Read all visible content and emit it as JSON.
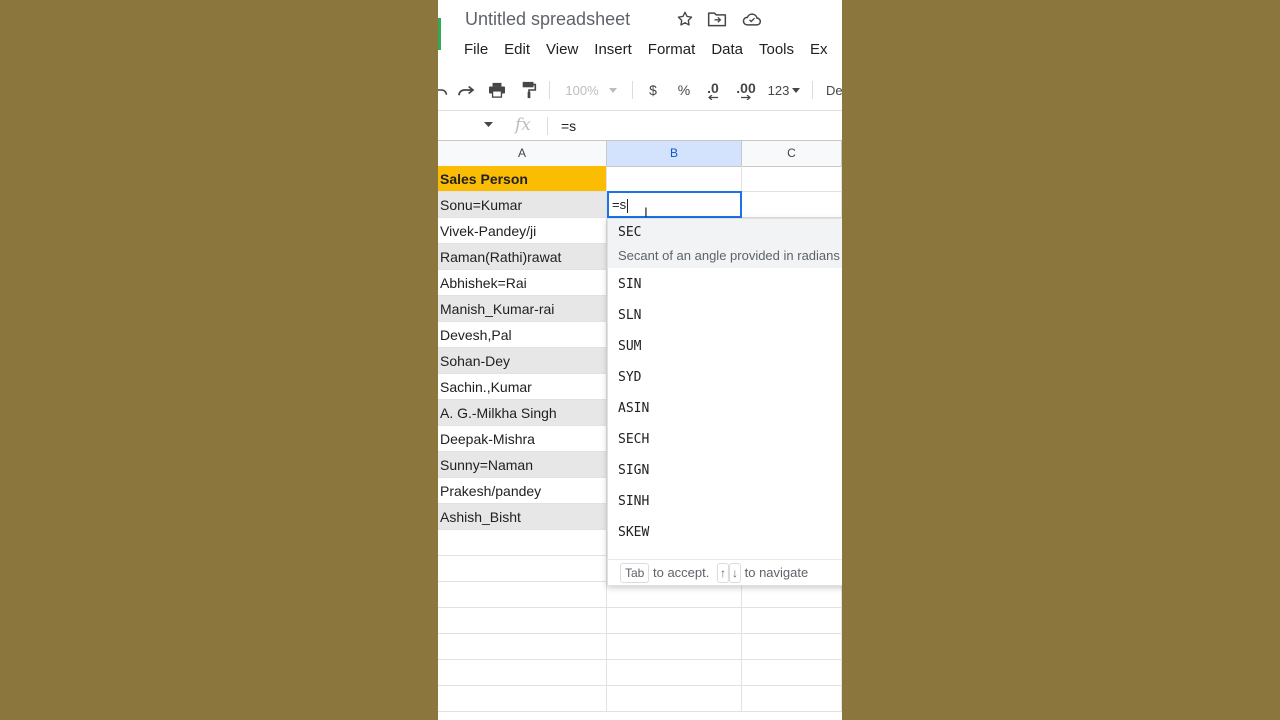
{
  "app": {
    "title": "Untitled spreadsheet",
    "accent": "#1a73e8",
    "brand": "#34a853",
    "header_fill": "#fbbc04"
  },
  "menu": [
    "File",
    "Edit",
    "View",
    "Insert",
    "Format",
    "Data",
    "Tools",
    "Ex"
  ],
  "toolbar": {
    "zoom": "100%",
    "currency": "$",
    "percent": "%",
    "dec_decrease": ".0",
    "dec_increase": ".00",
    "more_formats": "123",
    "font": "De"
  },
  "formula_bar": {
    "fx": "fx",
    "content": "=s"
  },
  "grid": {
    "columns": [
      "A",
      "B",
      "C"
    ],
    "rows": [
      "Sales Person",
      "Sonu=Kumar",
      "Vivek-Pandey/ji",
      "Raman(Rathi)rawat",
      "Abhishek=Rai",
      "Manish_Kumar-rai",
      "Devesh,Pal",
      "Sohan-Dey",
      "Sachin.,Kumar",
      "A. G.-Milkha Singh",
      "Deepak-Mishra",
      "Sunny=Naman",
      "Prakesh/pandey",
      "Ashish_Bisht"
    ],
    "editing_value": "=s"
  },
  "autocomplete": {
    "first": {
      "name": "SEC",
      "desc": "Secant of an angle provided in radians"
    },
    "items": [
      "SIN",
      "SLN",
      "SUM",
      "SYD",
      "ASIN",
      "SECH",
      "SIGN",
      "SINH",
      "SKEW"
    ],
    "footer": {
      "tab": "Tab",
      "accept": "to accept.",
      "up": "↑",
      "down": "↓",
      "navigate": "to navigate"
    }
  }
}
